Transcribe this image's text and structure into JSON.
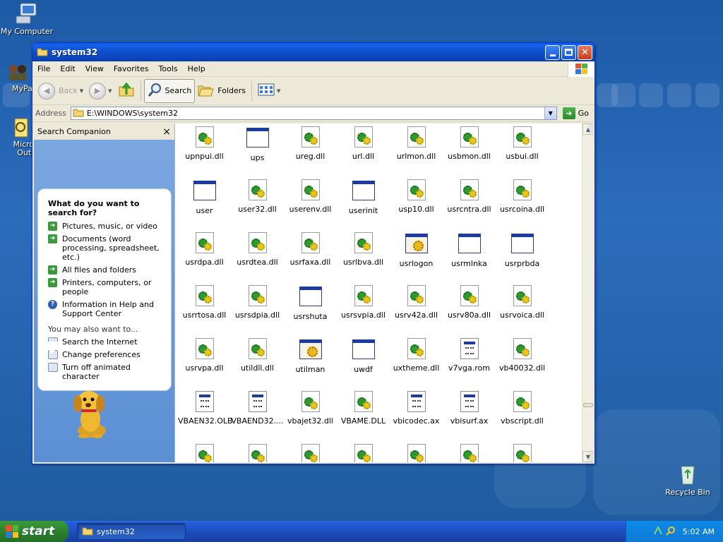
{
  "desktop": {
    "icons": [
      {
        "label": "My Computer"
      },
      {
        "label": "MyPa"
      },
      {
        "label": "Micros Outlo"
      },
      {
        "label": "Recycle Bin"
      }
    ]
  },
  "window": {
    "title": "system32",
    "menu": [
      "File",
      "Edit",
      "View",
      "Favorites",
      "Tools",
      "Help"
    ],
    "toolbar": {
      "back": "Back",
      "search": "Search",
      "folders": "Folders"
    },
    "address": {
      "label": "Address",
      "value": "E:\\WINDOWS\\system32",
      "go": "Go"
    },
    "companion": {
      "title": "Search Companion",
      "close": "×",
      "question": "What do you want to search for?",
      "options": [
        "Pictures, music, or video",
        "Documents (word processing, spreadsheet, etc.)",
        "All files and folders",
        "Printers, computers, or people"
      ],
      "help_option": "Information in Help and Support Center",
      "also_label": "You may also want to...",
      "also_options": [
        "Search the Internet",
        "Change preferences",
        "Turn off animated character"
      ]
    },
    "files": [
      {
        "name": "upnpui.dll",
        "type": "dll"
      },
      {
        "name": "ups",
        "type": "exe"
      },
      {
        "name": "ureg.dll",
        "type": "dll"
      },
      {
        "name": "url.dll",
        "type": "dll"
      },
      {
        "name": "urlmon.dll",
        "type": "dll"
      },
      {
        "name": "usbmon.dll",
        "type": "dll"
      },
      {
        "name": "usbui.dll",
        "type": "dll"
      },
      {
        "name": "user",
        "type": "exe"
      },
      {
        "name": "user32.dll",
        "type": "dll"
      },
      {
        "name": "userenv.dll",
        "type": "dll"
      },
      {
        "name": "userinit",
        "type": "exe"
      },
      {
        "name": "usp10.dll",
        "type": "dll"
      },
      {
        "name": "usrcntra.dll",
        "type": "dll"
      },
      {
        "name": "usrcoina.dll",
        "type": "dll"
      },
      {
        "name": "usrdpa.dll",
        "type": "dll"
      },
      {
        "name": "usrdtea.dll",
        "type": "dll"
      },
      {
        "name": "usrfaxa.dll",
        "type": "dll"
      },
      {
        "name": "usrlbva.dll",
        "type": "dll"
      },
      {
        "name": "usrlogon",
        "type": "util"
      },
      {
        "name": "usrmlnka",
        "type": "exe"
      },
      {
        "name": "usrprbda",
        "type": "exe"
      },
      {
        "name": "usrrtosa.dll",
        "type": "dll"
      },
      {
        "name": "usrsdpia.dll",
        "type": "dll"
      },
      {
        "name": "usrshuta",
        "type": "exe"
      },
      {
        "name": "usrsvpia.dll",
        "type": "dll"
      },
      {
        "name": "usrv42a.dll",
        "type": "dll"
      },
      {
        "name": "usrv80a.dll",
        "type": "dll"
      },
      {
        "name": "usrvoica.dll",
        "type": "dll"
      },
      {
        "name": "usrvpa.dll",
        "type": "dll"
      },
      {
        "name": "utildll.dll",
        "type": "dll"
      },
      {
        "name": "utilman",
        "type": "util"
      },
      {
        "name": "uwdf",
        "type": "exe"
      },
      {
        "name": "uxtheme.dll",
        "type": "dll"
      },
      {
        "name": "v7vga.rom",
        "type": "doc"
      },
      {
        "name": "vb40032.dll",
        "type": "dll"
      },
      {
        "name": "VBAEN32.OLB",
        "type": "doc"
      },
      {
        "name": "VBAEND32....",
        "type": "doc"
      },
      {
        "name": "vbajet32.dll",
        "type": "dll"
      },
      {
        "name": "VBAME.DLL",
        "type": "dll"
      },
      {
        "name": "vbicodec.ax",
        "type": "doc"
      },
      {
        "name": "vbisurf.ax",
        "type": "doc"
      },
      {
        "name": "vbscript.dll",
        "type": "dll"
      },
      {
        "name": "",
        "type": "dll"
      },
      {
        "name": "",
        "type": "dll"
      },
      {
        "name": "",
        "type": "dll"
      },
      {
        "name": "",
        "type": "dll"
      },
      {
        "name": "",
        "type": "dll"
      },
      {
        "name": "",
        "type": "dll"
      },
      {
        "name": "",
        "type": "dll"
      }
    ]
  },
  "taskbar": {
    "start": "start",
    "task": "system32",
    "clock": "5:02 AM"
  }
}
